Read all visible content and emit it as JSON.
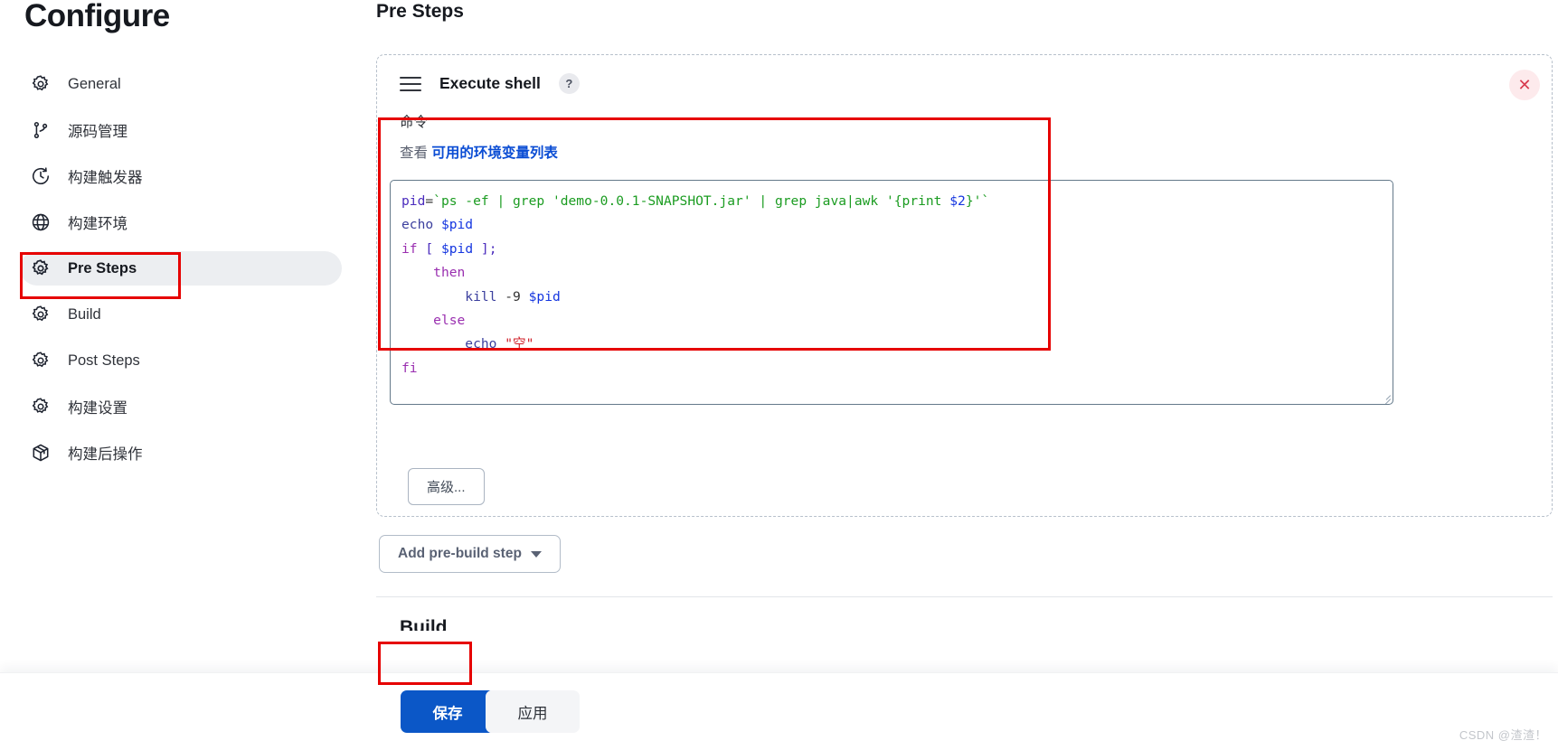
{
  "sidebar": {
    "title": "Configure",
    "items": [
      {
        "label": "General",
        "icon": "gear-icon",
        "active": false
      },
      {
        "label": "源码管理",
        "icon": "branch-icon",
        "active": false
      },
      {
        "label": "构建触发器",
        "icon": "clock-icon",
        "active": false
      },
      {
        "label": "构建环境",
        "icon": "globe-icon",
        "active": false
      },
      {
        "label": "Pre Steps",
        "icon": "gear-icon",
        "active": true
      },
      {
        "label": "Build",
        "icon": "gear-icon",
        "active": false
      },
      {
        "label": "Post Steps",
        "icon": "gear-icon",
        "active": false
      },
      {
        "label": "构建设置",
        "icon": "gear-icon",
        "active": false
      },
      {
        "label": "构建后操作",
        "icon": "box-icon",
        "active": false
      }
    ]
  },
  "main": {
    "section_title": "Pre Steps",
    "next_section_title": "Build",
    "step": {
      "name": "Execute shell",
      "help_label": "?",
      "close_label": "✕",
      "drag_handle_label": "drag-handle",
      "field_label": "命令",
      "env_prefix": "查看",
      "env_link": "可用的环境变量列表",
      "advanced_label": "高级...",
      "command_value": "pid=`ps -ef | grep 'demo-0.0.1-SNAPSHOT.jar' | grep java|awk '{print $2}'`\necho $pid\nif [ $pid ];\n    then\n        kill -9 $pid\n    else\n        echo \"空\"\nfi"
    },
    "add_step_label": "Add pre-build step"
  },
  "bottom": {
    "save_label": "保存",
    "apply_label": "应用"
  },
  "watermark": "CSDN @渣渣！",
  "colors": {
    "accent_blue": "#0b57c7",
    "link_blue": "#0b4dd4",
    "annotation_red": "#e60000",
    "active_nav_bg": "#eceef1",
    "close_btn_red": "#d83a4e"
  }
}
